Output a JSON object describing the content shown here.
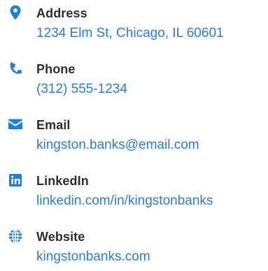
{
  "colors": {
    "accent": "#1e7fd8",
    "label": "#2d2d2d",
    "value": "#2e7bd1"
  },
  "contact": {
    "items": [
      {
        "key": "address",
        "icon": "map-pin-icon",
        "label": "Address",
        "value": "1234 Elm St, Chicago, IL 60601"
      },
      {
        "key": "phone",
        "icon": "phone-icon",
        "label": "Phone",
        "value": "(312) 555-1234"
      },
      {
        "key": "email",
        "icon": "envelope-icon",
        "label": "Email",
        "value": "kingston.banks@email.com"
      },
      {
        "key": "linkedin",
        "icon": "linkedin-icon",
        "label": "LinkedIn",
        "value": "linkedin.com/in/kingstonbanks"
      },
      {
        "key": "website",
        "icon": "globe-icon",
        "label": "Website",
        "value": "kingstonbanks.com"
      }
    ]
  }
}
